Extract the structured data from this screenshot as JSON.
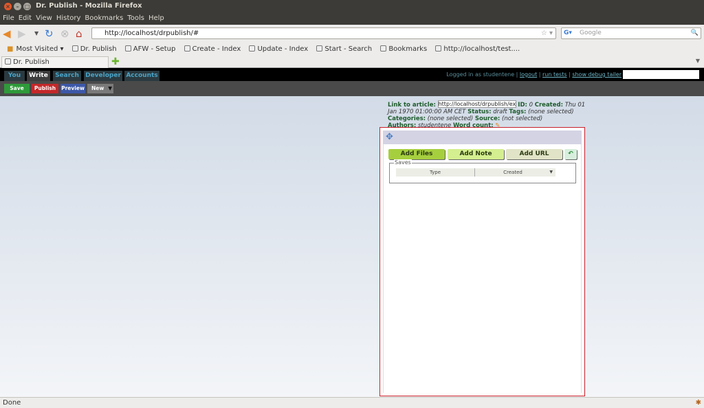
{
  "window": {
    "title": "Dr. Publish - Mozilla Firefox"
  },
  "menu": [
    "File",
    "Edit",
    "View",
    "History",
    "Bookmarks",
    "Tools",
    "Help"
  ],
  "nav": {
    "url": "http://localhost/drpublish/#",
    "search_placeholder": "Google"
  },
  "bookmarks": [
    "Most Visited ▾",
    "Dr. Publish",
    "AFW - Setup",
    "Create - Index",
    "Update - Index",
    "Start - Search",
    "Bookmarks",
    "http://localhost/test...."
  ],
  "tabs": [
    {
      "label": "Dr. Publish"
    }
  ],
  "app": {
    "tabs": [
      "You",
      "Write",
      "Search",
      "Developer",
      "Accounts"
    ],
    "active_tab": "Write",
    "login": {
      "prefix": "Logged in as studentene |",
      "logout": "logout",
      "run_tests": "run tests",
      "debug": "show debug tailer",
      "sep": "|"
    },
    "toolbar": {
      "save": "Save",
      "publish": "Publish",
      "preview": "Preview",
      "new": "New"
    },
    "meta": {
      "link_label": "Link to article:",
      "link_value": "http://localhost/drpublish/exa",
      "id_label": "ID:",
      "id_value": "0",
      "created_label": "Created:",
      "created_value": "Thu 01 Jan 1970 01:00:00 AM CET",
      "status_label": "Status:",
      "status_value": "draft",
      "tags_label": "Tags:",
      "tags_value": "(none selected)",
      "categories_label": "Categories:",
      "categories_value": "(none selected)",
      "source_label": "Source:",
      "source_value": "(not selected)",
      "authors_label": "Authors:",
      "authors_value": "studentene",
      "wordcount_label": "Word count:"
    },
    "panel": {
      "add_files": "Add Files",
      "add_note": "Add Note",
      "add_url": "Add URL",
      "saves_legend": "Saves",
      "columns": [
        "Type",
        "Created"
      ]
    }
  },
  "status": "Done",
  "colors": {
    "accent_red": "#c8202a",
    "save": "#2f9a3a",
    "publish": "#c4282a",
    "preview": "#3d58a8",
    "new": "#7a7a7a"
  }
}
